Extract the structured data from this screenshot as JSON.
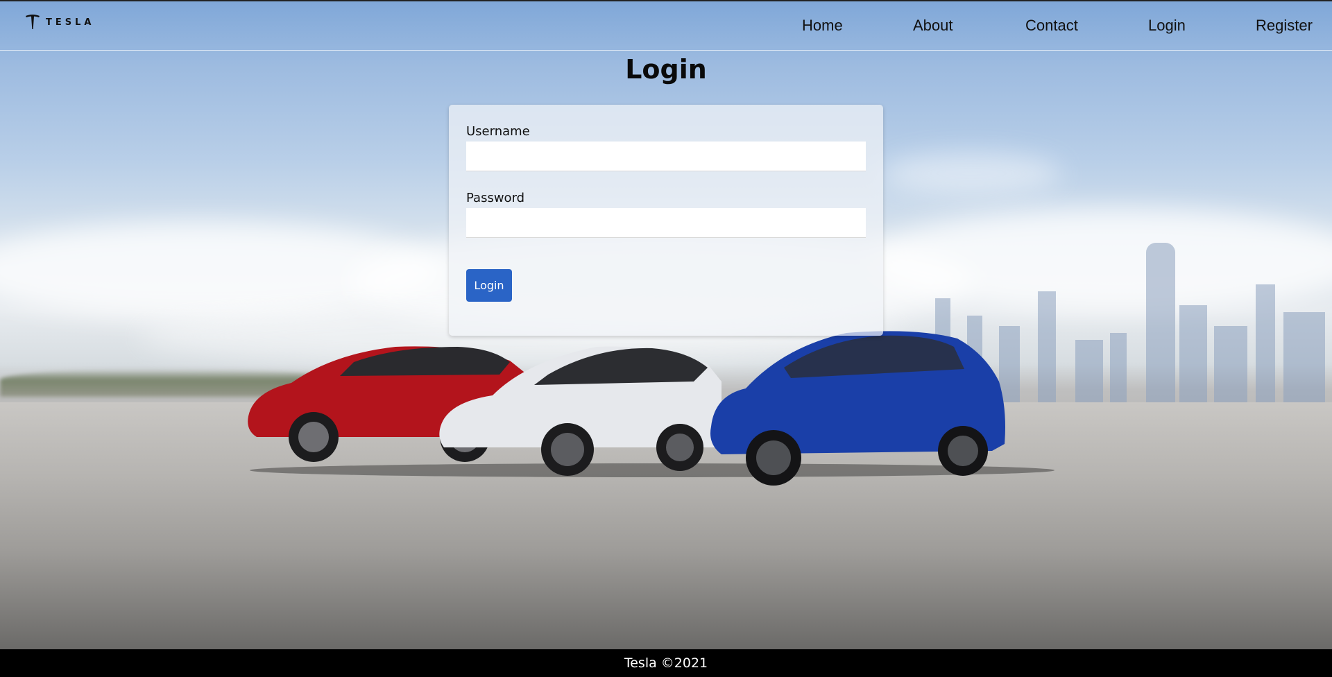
{
  "brand": {
    "logo_text": "TESLA"
  },
  "nav": {
    "items": [
      {
        "label": "Home"
      },
      {
        "label": "About"
      },
      {
        "label": "Contact"
      },
      {
        "label": "Login"
      },
      {
        "label": "Register"
      }
    ]
  },
  "main": {
    "title": "Login",
    "form": {
      "username_label": "Username",
      "username_value": "",
      "password_label": "Password",
      "password_value": "",
      "submit_label": "Login"
    }
  },
  "footer": {
    "text": "Tesla ©2021"
  },
  "colors": {
    "button": "#2a64c6",
    "footer_bg": "#000000",
    "car_red": "#b3141c",
    "car_white": "#e6e8ec",
    "car_blue": "#1a3fa8"
  }
}
